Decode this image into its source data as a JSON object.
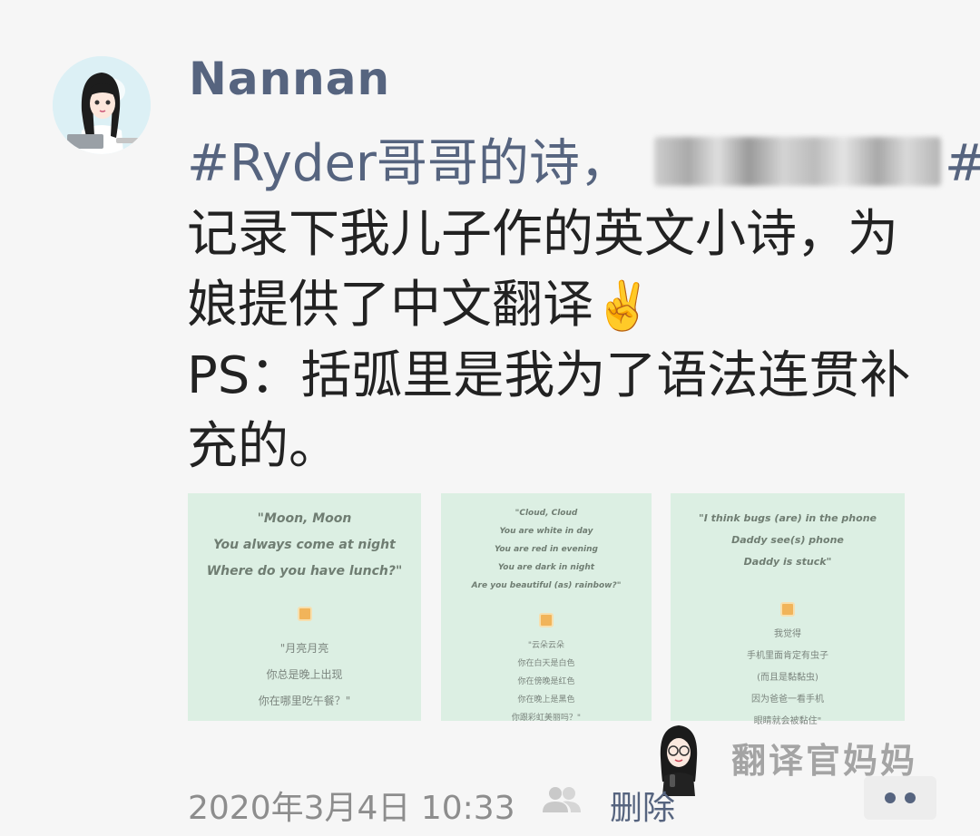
{
  "post": {
    "username": "Nannan",
    "hashtag_start": "#Ryder哥哥的诗，",
    "hashtag_end": "#",
    "lines": [
      "记录下我儿子作的英文小诗，为",
      "娘提供了中文翻译",
      "PS：括弧里是我为了语法连贯补",
      "充的。"
    ],
    "emoji": "✌️"
  },
  "photos": [
    {
      "en": [
        "\"Moon, Moon",
        "You always come at night",
        "Where do you have lunch?\""
      ],
      "zh": [
        "\"月亮月亮",
        "你总是晚上出现",
        "你在哪里吃午餐？\""
      ]
    },
    {
      "en": [
        "\"Cloud, Cloud",
        "You are white in day",
        "You are red in evening",
        "You are dark in night",
        "Are you beautiful (as) rainbow?\""
      ],
      "zh": [
        "\"云朵云朵",
        "你在白天是白色",
        "你在傍晚是红色",
        "你在晚上是黑色",
        "你跟彩虹美丽吗？\""
      ]
    },
    {
      "en": [
        "\"I think bugs (are) in the phone",
        "Daddy see(s) phone",
        "Daddy is stuck\""
      ],
      "zh": [
        "我觉得",
        "手机里面肯定有虫子",
        "(而且是黏黏虫)",
        "因为爸爸一看手机",
        "眼睛就会被黏住\""
      ]
    }
  ],
  "watermark": {
    "text": "翻译官妈妈"
  },
  "footer": {
    "timestamp": "2020年3月4日 10:33",
    "delete_label": "删除"
  },
  "icons": {
    "visibility": "friends-visibility-icon",
    "more": "more-options-icon"
  },
  "colors": {
    "name_blue": "#56647f",
    "photo_bg": "#dcefe3",
    "timestamp_gray": "#8d8d8d",
    "page_bg": "#f6f6f6"
  }
}
